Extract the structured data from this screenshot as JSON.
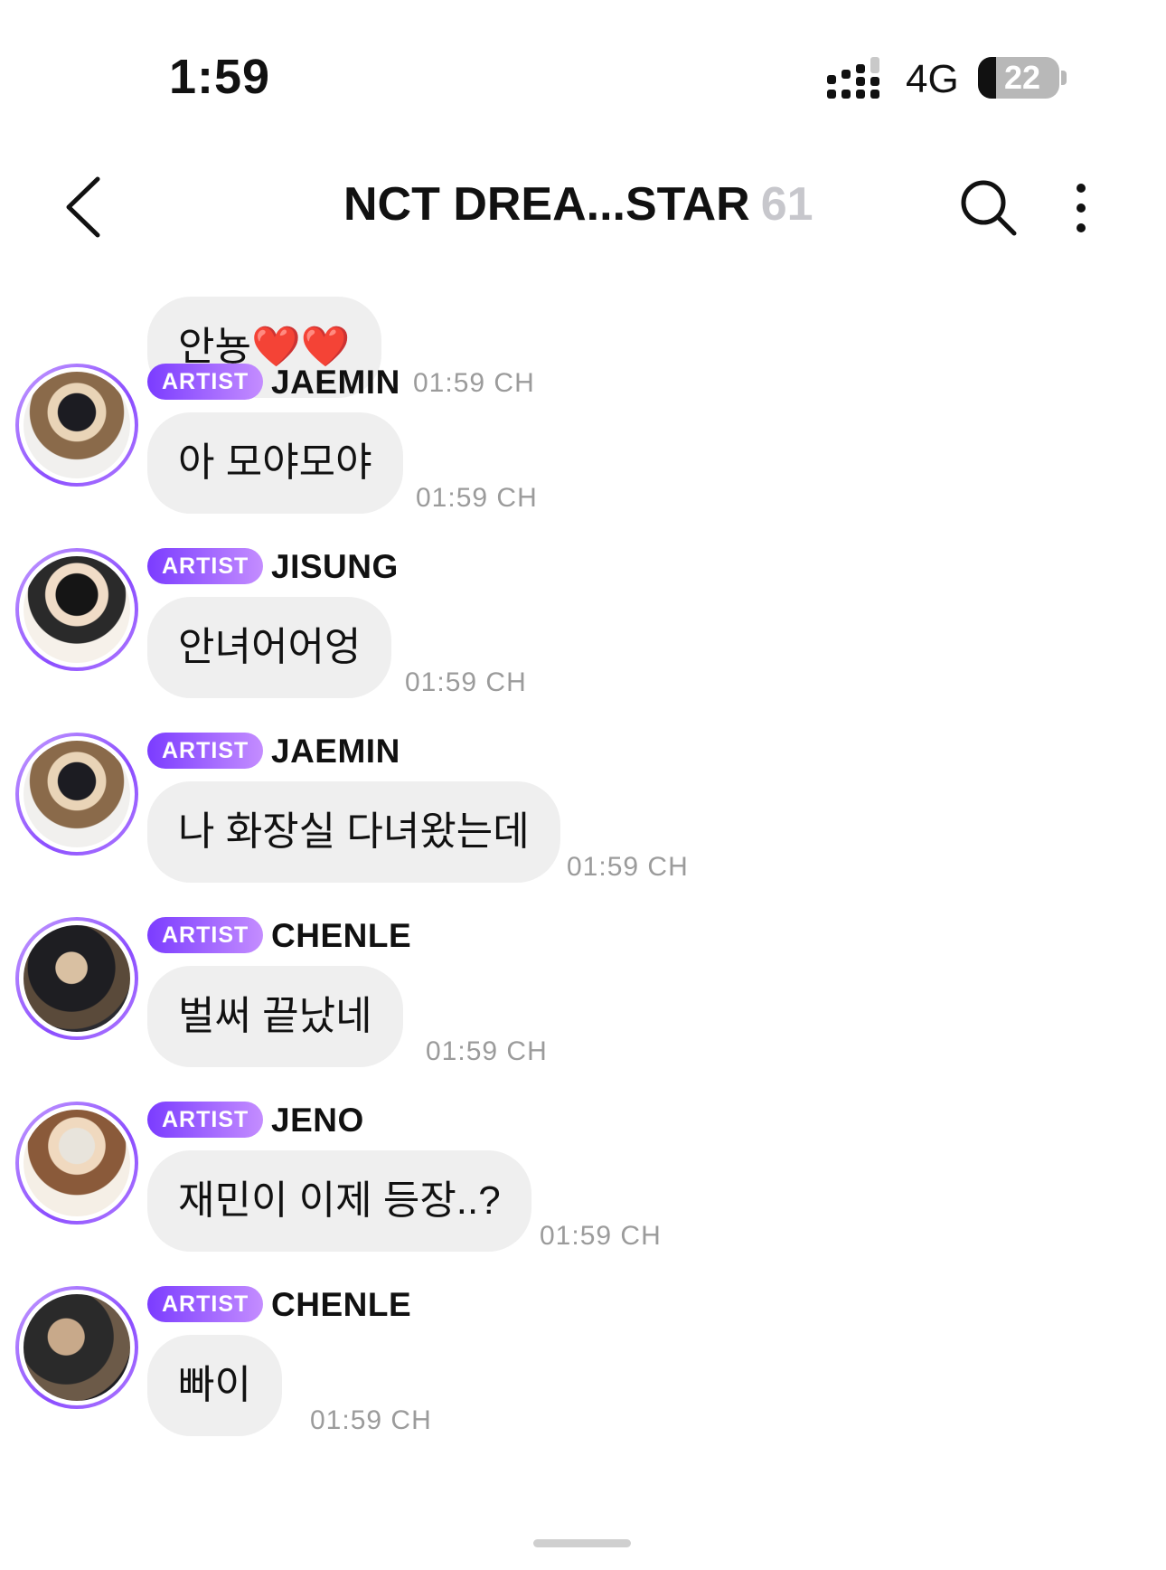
{
  "status_bar": {
    "time": "1:59",
    "network": "4G",
    "battery_level": "22",
    "battery_fraction": 0.22
  },
  "header": {
    "title": "NCT DREA...STAR",
    "member_count": "61"
  },
  "messages": [
    {
      "badge": "",
      "sender": "",
      "text": "안뇽❤️❤️",
      "time": "01:59 CH"
    },
    {
      "badge": "ARTIST",
      "sender": "JAEMIN",
      "text": "아 모야모야",
      "time": "01:59 CH"
    },
    {
      "badge": "ARTIST",
      "sender": "JISUNG",
      "text": "안녀어어엉",
      "time": "01:59 CH"
    },
    {
      "badge": "ARTIST",
      "sender": "JAEMIN",
      "text": "나 화장실 다녀왔는데",
      "time": "01:59 CH"
    },
    {
      "badge": "ARTIST",
      "sender": "CHENLE",
      "text": "벌써 끝났네",
      "time": "01:59 CH"
    },
    {
      "badge": "ARTIST",
      "sender": "JENO",
      "text": "재민이 이제 등장..?",
      "time": "01:59 CH"
    },
    {
      "badge": "ARTIST",
      "sender": "CHENLE",
      "text": "빠이",
      "time": "01:59 CH"
    }
  ],
  "colors": {
    "badge_start": "#7b3cff",
    "badge_end": "#c48dff",
    "bubble": "#efefef",
    "timestamp": "#9b9b9b"
  }
}
